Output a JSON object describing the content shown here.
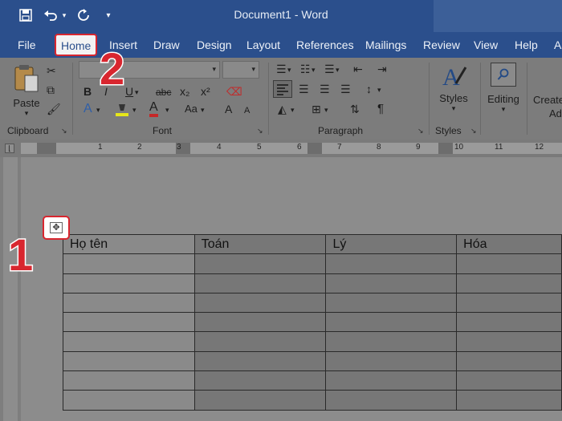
{
  "titlebar": {
    "title": "Document1  -  Word",
    "save_icon": "save-icon",
    "undo_icon": "undo-icon",
    "redo_icon": "redo-icon",
    "customize_icon": "customize-qat-icon"
  },
  "tabs": {
    "file": "File",
    "home": "Home",
    "insert": "Insert",
    "draw": "Draw",
    "design": "Design",
    "layout": "Layout",
    "references": "References",
    "mailings": "Mailings",
    "review": "Review",
    "view": "View",
    "help": "Help",
    "extra": "A"
  },
  "ribbon": {
    "clipboard": {
      "paste": "Paste",
      "label": "Clipboard"
    },
    "font": {
      "label": "Font",
      "bold": "B",
      "italic": "I",
      "underline": "U",
      "strike": "abc",
      "subscript": "x₂",
      "superscript": "x²",
      "text_effects": "A",
      "font_color": "A",
      "change_case": "Aa",
      "grow": "A",
      "shrink": "A"
    },
    "paragraph": {
      "label": "Paragraph",
      "pilcrow": "¶"
    },
    "styles": {
      "button": "Styles",
      "label": "Styles"
    },
    "editing": {
      "button": "Editing"
    },
    "create": {
      "line1": "Create",
      "line2": "Ad"
    }
  },
  "ruler": {
    "numbers": [
      "1",
      "2",
      "3",
      "4",
      "5",
      "6",
      "7",
      "8",
      "9",
      "10",
      "11",
      "12"
    ]
  },
  "table": {
    "headers": [
      "Họ tên",
      "Toán",
      "Lý",
      "Hóa"
    ],
    "empty_rows": 8
  },
  "annotations": {
    "step1": "1",
    "step2": "2"
  },
  "colors": {
    "accent": "#2b4f8c",
    "highlight_red": "#d8262f"
  }
}
